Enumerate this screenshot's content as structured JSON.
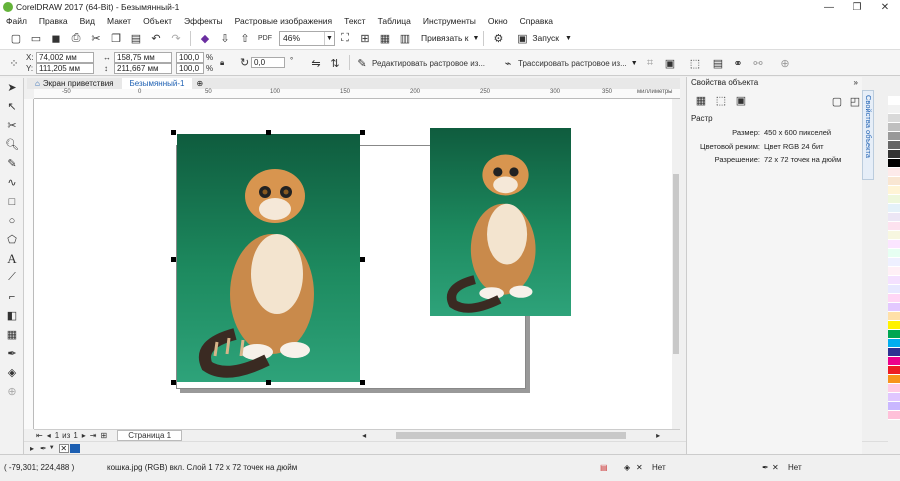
{
  "window": {
    "title": "CorelDRAW 2017 (64-Bit) - Безымянный-1",
    "minimize": "—",
    "restore": "❐",
    "close": "✕"
  },
  "menu": [
    "Файл",
    "Правка",
    "Вид",
    "Макет",
    "Объект",
    "Эффекты",
    "Растровые изображения",
    "Текст",
    "Таблица",
    "Инструменты",
    "Окно",
    "Справка"
  ],
  "stdbar": {
    "zoom": "46%",
    "snap_label": "Привязать к",
    "launch_label": "Запуск"
  },
  "propbar": {
    "x": "74,002 мм",
    "y": "111,205 мм",
    "x_label": "X:",
    "y_label": "Y:",
    "width": "158,75 мм",
    "height": "211,667 мм",
    "scale_w": "100,0",
    "scale_h": "100,0",
    "pct": "%",
    "angle": "0,0",
    "edit_bitmap": "Редактировать растровое из...",
    "trace_bitmap": "Трассировать растровое из..."
  },
  "tabs": [
    "Экран приветствия",
    "Безымянный-1"
  ],
  "ruler": {
    "top": [
      "-50",
      "0",
      "50",
      "100",
      "150",
      "200",
      "250",
      "300",
      "350"
    ],
    "unit": "миллиметры"
  },
  "docker": {
    "title": "Свойства объекта",
    "section": "Растр",
    "props": [
      {
        "key": "Размер:",
        "val": "450 x 600 пикселей"
      },
      {
        "key": "Цветовой режим:",
        "val": "Цвет RGB 24 бит"
      },
      {
        "key": "Разрешение:",
        "val": "72 x 72 точек на дюйм"
      }
    ],
    "vertical_tab": "Свойства объекта"
  },
  "pagenav": {
    "current": "1",
    "of": "из",
    "total": "1",
    "page_tab": "Страница 1"
  },
  "status": {
    "coords": "( -79,301; 224,488 )",
    "info": "кошка.jpg (RGB) вкл. Слой 1 72 x 72 точек на дюйм",
    "fill": "Нет",
    "outline": "Нет"
  },
  "colors": {
    "accent": "#1c5fb2",
    "green_bg": "#1d8a5f",
    "palette": [
      "#ffffff",
      "#f2f2f2",
      "#d9d9d9",
      "#bfbfbf",
      "#999999",
      "#666666",
      "#333333",
      "#000000",
      "#fdeaea",
      "#f9e6d2",
      "#fff4d6",
      "#eef7dc",
      "#e4f1f9",
      "#ece6f5",
      "#fde2ef",
      "#f7f7e0",
      "#fbe5ff",
      "#e6fff2",
      "#eef0ff",
      "#fff0f6",
      "#f4e1ff",
      "#e8e8ff",
      "#ffd6f5",
      "#e3c8ff",
      "#ffe0a8",
      "#fff200",
      "#00a651",
      "#00aeef",
      "#2e3192",
      "#ec008c",
      "#ed1c24",
      "#f7941d",
      "#ffcce6",
      "#e0c6ff",
      "#c9b7ff",
      "#ffc0d9"
    ]
  }
}
